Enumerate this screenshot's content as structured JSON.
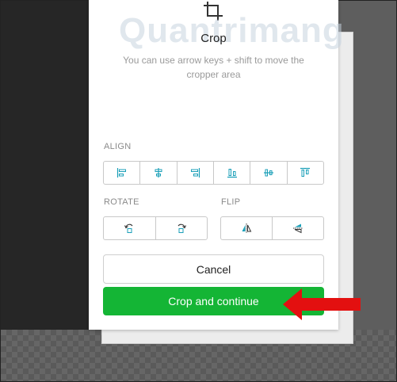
{
  "panel": {
    "title": "Crop",
    "hint": "You can use arrow keys + shift to move the cropper area",
    "watermark": "Quantrimang"
  },
  "align": {
    "label": "ALIGN",
    "buttons": [
      "align-left-icon",
      "align-center-horizontal-icon",
      "align-right-icon",
      "align-bottom-icon",
      "align-center-vertical-icon",
      "align-top-icon"
    ]
  },
  "rotate": {
    "label": "ROTATE",
    "buttons": [
      "rotate-left-icon",
      "rotate-right-icon"
    ]
  },
  "flip": {
    "label": "FLIP",
    "buttons": [
      "flip-horizontal-icon",
      "flip-vertical-icon"
    ]
  },
  "actions": {
    "cancel_label": "Cancel",
    "primary_label": "Crop and continue"
  },
  "colors": {
    "primary": "#14b535",
    "annotation_arrow": "#e31010",
    "icon": "#1a9fb8"
  }
}
